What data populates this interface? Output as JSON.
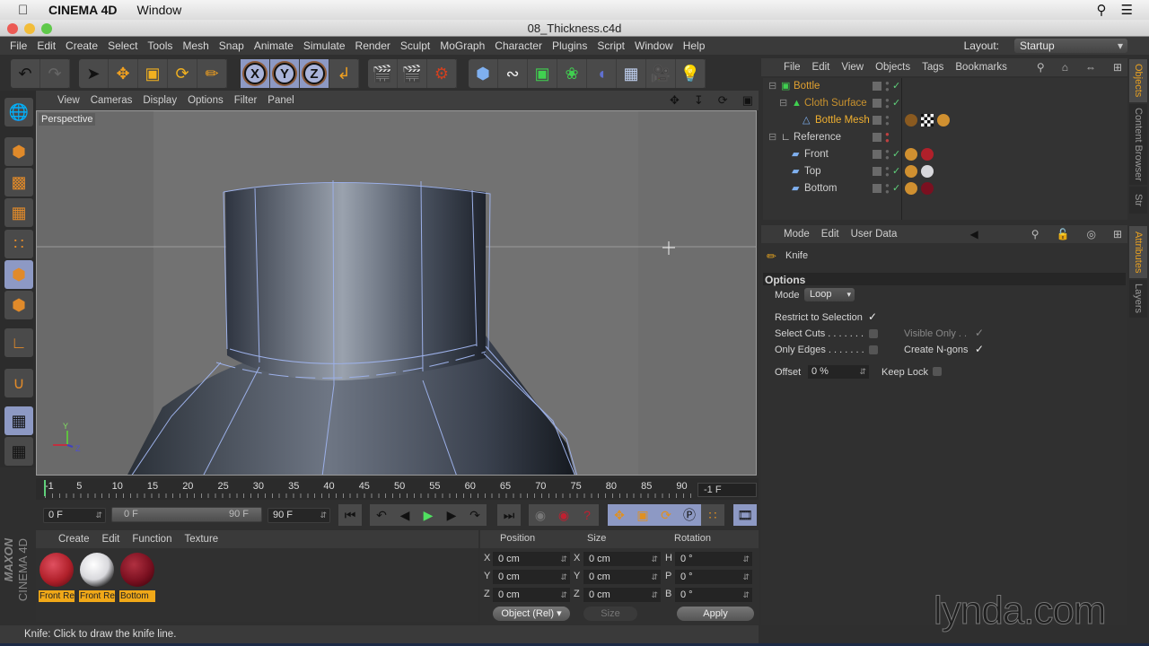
{
  "mac_menubar": {
    "app_name": "CINEMA 4D",
    "menu": "Window"
  },
  "window": {
    "title": "08_Thickness.c4d"
  },
  "app_menu": {
    "items": [
      "File",
      "Edit",
      "Create",
      "Select",
      "Tools",
      "Mesh",
      "Snap",
      "Animate",
      "Simulate",
      "Render",
      "Sculpt",
      "MoGraph",
      "Character",
      "Plugins",
      "Script",
      "Window",
      "Help"
    ],
    "layout_label": "Layout:",
    "layout_value": "Startup"
  },
  "toolbar": {
    "groups": [
      [
        "undo-icon",
        "redo-icon"
      ],
      [
        "select-arrow-icon",
        "move-icon",
        "scale-icon",
        "rotate-icon",
        "knife-icon"
      ],
      [
        "x-axis-icon",
        "y-axis-icon",
        "z-axis-icon",
        "coordinate-system-icon"
      ],
      [
        "render-view-icon",
        "render-picture-viewer-icon",
        "render-settings-icon"
      ],
      [
        "cube-icon",
        "spline-pen-icon",
        "subdivision-icon",
        "cloner-icon",
        "deformer-icon",
        "floor-icon",
        "camera-icon",
        "light-icon"
      ]
    ],
    "axis_labels": [
      "X",
      "Y",
      "Z"
    ]
  },
  "left_palette": [
    "make-editable-icon",
    "model-mode-icon",
    "texture-mode-icon",
    "workplane-icon",
    "points-mode-icon",
    "edges-mode-icon",
    "polygons-mode-icon",
    "axis-mode-icon",
    "snap-magnet-icon",
    "locked-workplane-icon",
    "planar-workplane-icon"
  ],
  "viewport": {
    "menu": [
      "View",
      "Cameras",
      "Display",
      "Options",
      "Filter",
      "Panel"
    ],
    "label": "Perspective",
    "axis": {
      "y": "Y",
      "z": "Z"
    }
  },
  "timeline": {
    "ticks": [
      "-1",
      "5",
      "10",
      "15",
      "20",
      "25",
      "30",
      "35",
      "40",
      "45",
      "50",
      "55",
      "60",
      "65",
      "70",
      "75",
      "80",
      "85",
      "90"
    ],
    "current_frame": "-1 F",
    "start_field": "0 F",
    "range_start": "0 F",
    "range_end": "90 F",
    "end_field": "90 F"
  },
  "material_manager": {
    "menu": [
      "Create",
      "Edit",
      "Function",
      "Texture"
    ],
    "materials": [
      {
        "name": "Front Re",
        "color": "#b0202a"
      },
      {
        "name": "Front Re",
        "color": "#d8d8dc"
      },
      {
        "name": "Bottom",
        "color": "#7a1020"
      }
    ]
  },
  "branding": {
    "maxon": "MAXON",
    "product": "CINEMA 4D",
    "watermark": "lynda.com"
  },
  "coordinates": {
    "headers": [
      "Position",
      "Size",
      "Rotation"
    ],
    "position": [
      {
        "axis": "X",
        "value": "0 cm"
      },
      {
        "axis": "Y",
        "value": "0 cm"
      },
      {
        "axis": "Z",
        "value": "0 cm"
      }
    ],
    "size": [
      {
        "axis": "X",
        "value": "0 cm"
      },
      {
        "axis": "Y",
        "value": "0 cm"
      },
      {
        "axis": "Z",
        "value": "0 cm"
      }
    ],
    "rotation": [
      {
        "axis": "H",
        "value": "0 °"
      },
      {
        "axis": "P",
        "value": "0 °"
      },
      {
        "axis": "B",
        "value": "0 °"
      }
    ],
    "mode": "Object (Rel)",
    "size_mode": "Size",
    "apply_label": "Apply"
  },
  "status_bar": {
    "text": "Knife: Click to draw the knife line."
  },
  "object_manager": {
    "menu": [
      "File",
      "Edit",
      "View",
      "Objects",
      "Tags",
      "Bookmarks"
    ],
    "objects": [
      {
        "name": "Bottle",
        "level": 0,
        "color": "#e0a030",
        "icon": "subdivision-surface-icon",
        "check": true,
        "tags": []
      },
      {
        "name": "Cloth Surface",
        "level": 1,
        "color": "#c9922e",
        "icon": "cloth-surface-icon",
        "check": true,
        "tags": []
      },
      {
        "name": "Bottle Mesh",
        "level": 2,
        "color": "#f0b030",
        "icon": "polygon-object-icon",
        "check": false,
        "tags": [
          "cloth-tag",
          "texture-checker-tag",
          "phong-tag"
        ]
      },
      {
        "name": "Reference",
        "level": 0,
        "color": "#cfcfcf",
        "icon": "null-object-icon",
        "check": false,
        "tags": []
      },
      {
        "name": "Front",
        "level": 1,
        "color": "#cfcfcf",
        "icon": "plane-icon",
        "check": true,
        "tags": [
          "phong-tag",
          "material-red-tag"
        ]
      },
      {
        "name": "Top",
        "level": 1,
        "color": "#cfcfcf",
        "icon": "plane-icon",
        "check": true,
        "tags": [
          "phong-tag",
          "material-white-tag"
        ]
      },
      {
        "name": "Bottom",
        "level": 1,
        "color": "#cfcfcf",
        "icon": "plane-icon",
        "check": true,
        "tags": [
          "phong-tag",
          "material-darkred-tag"
        ]
      }
    ]
  },
  "attributes": {
    "menu": [
      "Mode",
      "Edit",
      "User Data"
    ],
    "tool_name": "Knife",
    "section": "Options",
    "mode_label": "Mode",
    "mode_value": "Loop",
    "restrict_to_selection": {
      "label": "Restrict to Selection",
      "checked": true
    },
    "select_cuts": {
      "label": "Select Cuts . . . . . . .",
      "checked": false
    },
    "visible_only": {
      "label": "Visible Only . .",
      "checked": true,
      "disabled": true
    },
    "only_edges": {
      "label": "Only Edges . . . . . . .",
      "checked": false
    },
    "create_ngons": {
      "label": "Create N-gons",
      "checked": true
    },
    "offset_label": "Offset",
    "offset_value": "0 %",
    "keep_lock": {
      "label": "Keep Lock",
      "checked": false
    }
  },
  "side_tabs": {
    "top": [
      "Objects",
      "Content Browser",
      "Str"
    ],
    "bottom": [
      "Attributes",
      "Layers"
    ]
  },
  "colors": {
    "accent_orange": "#e8a020",
    "active_blue": "#8d99c4"
  }
}
